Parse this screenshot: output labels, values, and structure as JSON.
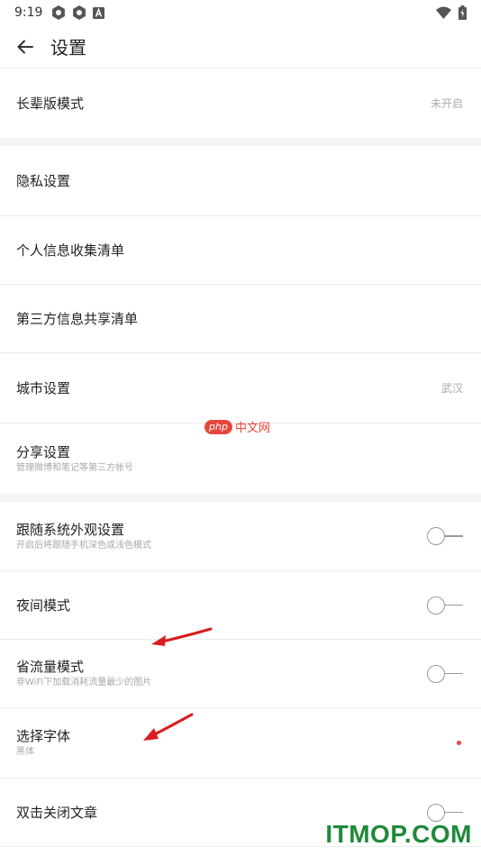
{
  "status_bar": {
    "time": "9:19",
    "icons": [
      "settings-gear-icon",
      "settings-gear-icon",
      "font-a-icon"
    ],
    "right_icons": [
      "wifi-icon",
      "battery-icon"
    ]
  },
  "header": {
    "back_icon": "back-arrow-icon",
    "title": "设置"
  },
  "sections": [
    {
      "rows": [
        {
          "id": "elder-mode",
          "title": "长辈版模式",
          "value": "未开启"
        }
      ]
    },
    {
      "rows": [
        {
          "id": "privacy",
          "title": "隐私设置"
        },
        {
          "id": "personal-info",
          "title": "个人信息收集清单"
        },
        {
          "id": "third-party",
          "title": "第三方信息共享清单"
        },
        {
          "id": "city",
          "title": "城市设置",
          "value": "武汉"
        },
        {
          "id": "share",
          "title": "分享设置",
          "subtitle": "管理微博和笔记等第三方帐号"
        }
      ]
    },
    {
      "rows": [
        {
          "id": "follow-system",
          "title": "跟随系统外观设置",
          "subtitle": "开启后将跟随手机深色或浅色模式",
          "toggle": false
        },
        {
          "id": "night-mode",
          "title": "夜间模式",
          "toggle": false
        },
        {
          "id": "data-saver",
          "title": "省流量模式",
          "subtitle": "非WiFi下加载消耗流量最少的图片",
          "toggle": false
        },
        {
          "id": "font",
          "title": "选择字体",
          "subtitle": "黑体",
          "indicator": "red-dot"
        },
        {
          "id": "double-tap-close",
          "title": "双击关闭文章",
          "toggle": false
        }
      ]
    }
  ],
  "watermarks": {
    "php_badge": "php",
    "php_text": "中文网",
    "itmop": "ITMOP.COM"
  },
  "colors": {
    "accent_red": "#e8453c",
    "watermark_green": "#1f8a3a",
    "toggle_off": "#9a9a9a",
    "section_gap": "#f3f3f3"
  }
}
